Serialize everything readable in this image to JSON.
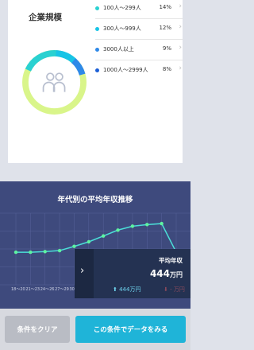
{
  "company_size": {
    "title": "企業規模",
    "items": [
      {
        "label": "100人〜299人",
        "pct": "14%",
        "value": 14,
        "color": "#2ad1d1"
      },
      {
        "label": "300人〜999人",
        "pct": "12%",
        "value": 12,
        "color": "#18c4e6"
      },
      {
        "label": "3000人以上",
        "pct": "9%",
        "value": 9,
        "color": "#2e89e8"
      },
      {
        "label": "1000人〜2999人",
        "pct": "8%",
        "value": 8,
        "color": "#1b5fd6"
      }
    ],
    "ring_colors": [
      "#d9f58a",
      "#2ad1d1",
      "#18c4e6",
      "#2e89e8"
    ],
    "icon": "people-icon"
  },
  "trend": {
    "title": "年代別の平均年収推移"
  },
  "chart_data": {
    "type": "line",
    "title": "年代別の平均年収推移",
    "x": [
      "18〜20",
      "21〜23",
      "24〜26",
      "27〜29",
      "30〜",
      "",
      "",
      "",
      "",
      "",
      "",
      ""
    ],
    "values": [
      300,
      300,
      302,
      305,
      318,
      332,
      350,
      368,
      380,
      385,
      388,
      300
    ],
    "ylim": [
      200,
      420
    ],
    "line_color": "#4be0d8",
    "point_color": "#5ef3a0"
  },
  "popup": {
    "label": "平均年収",
    "value": "444",
    "unit": "万円",
    "up_text": "444万円",
    "down_text": "- 万円"
  },
  "buttons": {
    "clear": "条件をクリア",
    "search": "この条件でデータをみる"
  }
}
